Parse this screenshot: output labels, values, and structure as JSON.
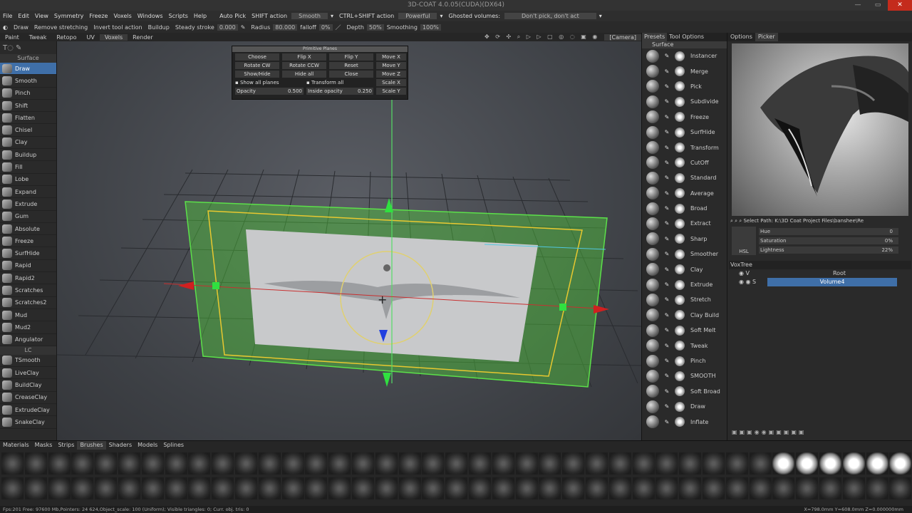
{
  "window": {
    "title": "3D-COAT 4.0.05(CUDA)(DX64)"
  },
  "menu": {
    "items": [
      "File",
      "Edit",
      "View",
      "Symmetry",
      "Freeze",
      "Voxels",
      "Windows",
      "Scripts",
      "Help"
    ],
    "auto_pick": "Auto Pick",
    "shift_action_label": "SHIFT action",
    "shift_action_value": "Smooth",
    "ctrl_shift_label": "CTRL+SHIFT action",
    "ctrl_shift_value": "Powerful",
    "ghosted_label": "Ghosted volumes:",
    "ghosted_value": "Don't pick, don't act"
  },
  "toolbar": {
    "tool": "Draw",
    "remove_stretching": "Remove stretching",
    "invert": "Invert tool action",
    "buildup": "Buildup",
    "steady_label": "Steady stroke",
    "steady_value": "0.000",
    "radius_label": "Radius",
    "radius_value": "80.000",
    "falloff_label": "falloff",
    "falloff_value": "0%",
    "depth_label": "Depth",
    "depth_value": "50%",
    "smoothing_label": "Smoothing",
    "smoothing_value": "100%",
    "camera": "[Camera]"
  },
  "room_tabs": [
    "Paint",
    "Tweak",
    "Retopo",
    "UV",
    "Voxels",
    "Render"
  ],
  "left_tools": {
    "section1": "Surface",
    "items1": [
      "Draw",
      "Smooth",
      "Pinch",
      "Shift",
      "Flatten",
      "Chisel",
      "Clay",
      "Buildup",
      "Fill",
      "Lobe",
      "Expand",
      "Extrude",
      "Gum",
      "Absolute",
      "Freeze",
      "SurfHide",
      "Rapid",
      "Rapid2",
      "Scratches",
      "Scratches2",
      "Mud",
      "Mud2",
      "Angulator"
    ],
    "section2": "LC",
    "items2": [
      "TSmooth",
      "LiveClay",
      "BuildClay",
      "CreaseClay",
      "ExtrudeClay",
      "SnakeClay"
    ]
  },
  "plane_panel": {
    "title": "Primitive Planes",
    "buttons": [
      "Choose",
      "Flip X",
      "Flip Y",
      "Move X",
      "Rotate CW",
      "Rotate CCW",
      "Reset",
      "Move Y",
      "Show/Hide",
      "Hide all",
      "Close",
      "Move Z"
    ],
    "show_all": "Show all planes",
    "transform_all": "Transform all",
    "opacity_label": "Opacity",
    "opacity_value": "0.500",
    "inside_label": "Inside opacity",
    "inside_value": "0.250",
    "scale_x": "Scale X",
    "scale_y": "Scale Y"
  },
  "right_panel": {
    "tabs": [
      "Presets",
      "Tool Options"
    ],
    "section": "Surface",
    "tools": [
      "Instancer",
      "Merge",
      "Pick",
      "Subdivide",
      "Freeze",
      "SurfHide",
      "Transform",
      "CutOff",
      "Standard",
      "Average",
      "Broad",
      "Extract",
      "Sharp",
      "Smoother",
      "Clay",
      "Extrude",
      "Stretch",
      "Clay Build",
      "Soft Melt",
      "Tweak",
      "Pinch",
      "SMOOTH",
      "Soft Broad",
      "Draw",
      "Inflate"
    ]
  },
  "ref_panel": {
    "tabs": [
      "Options",
      "Picker"
    ],
    "path": "Select Path: K:\\3D Coat Project Files\\banshee\\Re",
    "hue_label": "Hue",
    "hue_value": "0",
    "sat_label": "Saturation",
    "sat_value": "0%",
    "light_label": "Lightness",
    "light_value": "22%",
    "hsl": "HSL"
  },
  "voxtree": {
    "title": "VoxTree",
    "root": "Root",
    "volume": "Volume4"
  },
  "bottom_tabs": [
    "Materials",
    "Masks",
    "Strips",
    "Brushes",
    "Shaders",
    "Models",
    "Splines"
  ],
  "status": {
    "left": "Fps:201   Free: 97600 Mb,Pointers: 24 624,Object_scale: 100 (Uniform); Visible triangles: 0; Curr. obj. tris: 0",
    "right": "X=798.0mm Y=608.0mm Z=0.000000mm"
  }
}
